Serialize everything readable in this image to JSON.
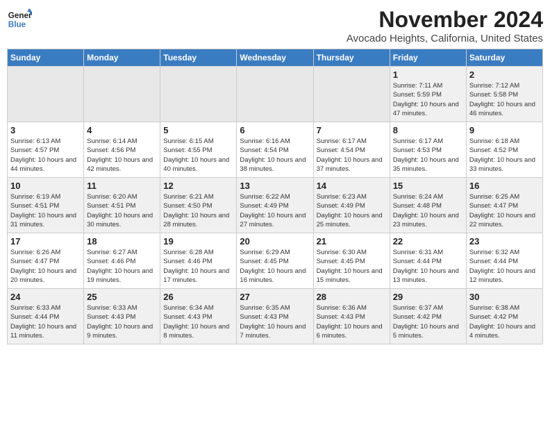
{
  "logo": {
    "line1": "General",
    "line2": "Blue"
  },
  "header": {
    "month": "November 2024",
    "location": "Avocado Heights, California, United States"
  },
  "weekdays": [
    "Sunday",
    "Monday",
    "Tuesday",
    "Wednesday",
    "Thursday",
    "Friday",
    "Saturday"
  ],
  "weeks": [
    [
      {
        "day": "",
        "info": ""
      },
      {
        "day": "",
        "info": ""
      },
      {
        "day": "",
        "info": ""
      },
      {
        "day": "",
        "info": ""
      },
      {
        "day": "",
        "info": ""
      },
      {
        "day": "1",
        "info": "Sunrise: 7:11 AM\nSunset: 5:59 PM\nDaylight: 10 hours and 47 minutes."
      },
      {
        "day": "2",
        "info": "Sunrise: 7:12 AM\nSunset: 5:58 PM\nDaylight: 10 hours and 46 minutes."
      }
    ],
    [
      {
        "day": "3",
        "info": "Sunrise: 6:13 AM\nSunset: 4:57 PM\nDaylight: 10 hours and 44 minutes."
      },
      {
        "day": "4",
        "info": "Sunrise: 6:14 AM\nSunset: 4:56 PM\nDaylight: 10 hours and 42 minutes."
      },
      {
        "day": "5",
        "info": "Sunrise: 6:15 AM\nSunset: 4:55 PM\nDaylight: 10 hours and 40 minutes."
      },
      {
        "day": "6",
        "info": "Sunrise: 6:16 AM\nSunset: 4:54 PM\nDaylight: 10 hours and 38 minutes."
      },
      {
        "day": "7",
        "info": "Sunrise: 6:17 AM\nSunset: 4:54 PM\nDaylight: 10 hours and 37 minutes."
      },
      {
        "day": "8",
        "info": "Sunrise: 6:17 AM\nSunset: 4:53 PM\nDaylight: 10 hours and 35 minutes."
      },
      {
        "day": "9",
        "info": "Sunrise: 6:18 AM\nSunset: 4:52 PM\nDaylight: 10 hours and 33 minutes."
      }
    ],
    [
      {
        "day": "10",
        "info": "Sunrise: 6:19 AM\nSunset: 4:51 PM\nDaylight: 10 hours and 31 minutes."
      },
      {
        "day": "11",
        "info": "Sunrise: 6:20 AM\nSunset: 4:51 PM\nDaylight: 10 hours and 30 minutes."
      },
      {
        "day": "12",
        "info": "Sunrise: 6:21 AM\nSunset: 4:50 PM\nDaylight: 10 hours and 28 minutes."
      },
      {
        "day": "13",
        "info": "Sunrise: 6:22 AM\nSunset: 4:49 PM\nDaylight: 10 hours and 27 minutes."
      },
      {
        "day": "14",
        "info": "Sunrise: 6:23 AM\nSunset: 4:49 PM\nDaylight: 10 hours and 25 minutes."
      },
      {
        "day": "15",
        "info": "Sunrise: 6:24 AM\nSunset: 4:48 PM\nDaylight: 10 hours and 23 minutes."
      },
      {
        "day": "16",
        "info": "Sunrise: 6:25 AM\nSunset: 4:47 PM\nDaylight: 10 hours and 22 minutes."
      }
    ],
    [
      {
        "day": "17",
        "info": "Sunrise: 6:26 AM\nSunset: 4:47 PM\nDaylight: 10 hours and 20 minutes."
      },
      {
        "day": "18",
        "info": "Sunrise: 6:27 AM\nSunset: 4:46 PM\nDaylight: 10 hours and 19 minutes."
      },
      {
        "day": "19",
        "info": "Sunrise: 6:28 AM\nSunset: 4:46 PM\nDaylight: 10 hours and 17 minutes."
      },
      {
        "day": "20",
        "info": "Sunrise: 6:29 AM\nSunset: 4:45 PM\nDaylight: 10 hours and 16 minutes."
      },
      {
        "day": "21",
        "info": "Sunrise: 6:30 AM\nSunset: 4:45 PM\nDaylight: 10 hours and 15 minutes."
      },
      {
        "day": "22",
        "info": "Sunrise: 6:31 AM\nSunset: 4:44 PM\nDaylight: 10 hours and 13 minutes."
      },
      {
        "day": "23",
        "info": "Sunrise: 6:32 AM\nSunset: 4:44 PM\nDaylight: 10 hours and 12 minutes."
      }
    ],
    [
      {
        "day": "24",
        "info": "Sunrise: 6:33 AM\nSunset: 4:44 PM\nDaylight: 10 hours and 11 minutes."
      },
      {
        "day": "25",
        "info": "Sunrise: 6:33 AM\nSunset: 4:43 PM\nDaylight: 10 hours and 9 minutes."
      },
      {
        "day": "26",
        "info": "Sunrise: 6:34 AM\nSunset: 4:43 PM\nDaylight: 10 hours and 8 minutes."
      },
      {
        "day": "27",
        "info": "Sunrise: 6:35 AM\nSunset: 4:43 PM\nDaylight: 10 hours and 7 minutes."
      },
      {
        "day": "28",
        "info": "Sunrise: 6:36 AM\nSunset: 4:43 PM\nDaylight: 10 hours and 6 minutes."
      },
      {
        "day": "29",
        "info": "Sunrise: 6:37 AM\nSunset: 4:42 PM\nDaylight: 10 hours and 5 minutes."
      },
      {
        "day": "30",
        "info": "Sunrise: 6:38 AM\nSunset: 4:42 PM\nDaylight: 10 hours and 4 minutes."
      }
    ]
  ]
}
